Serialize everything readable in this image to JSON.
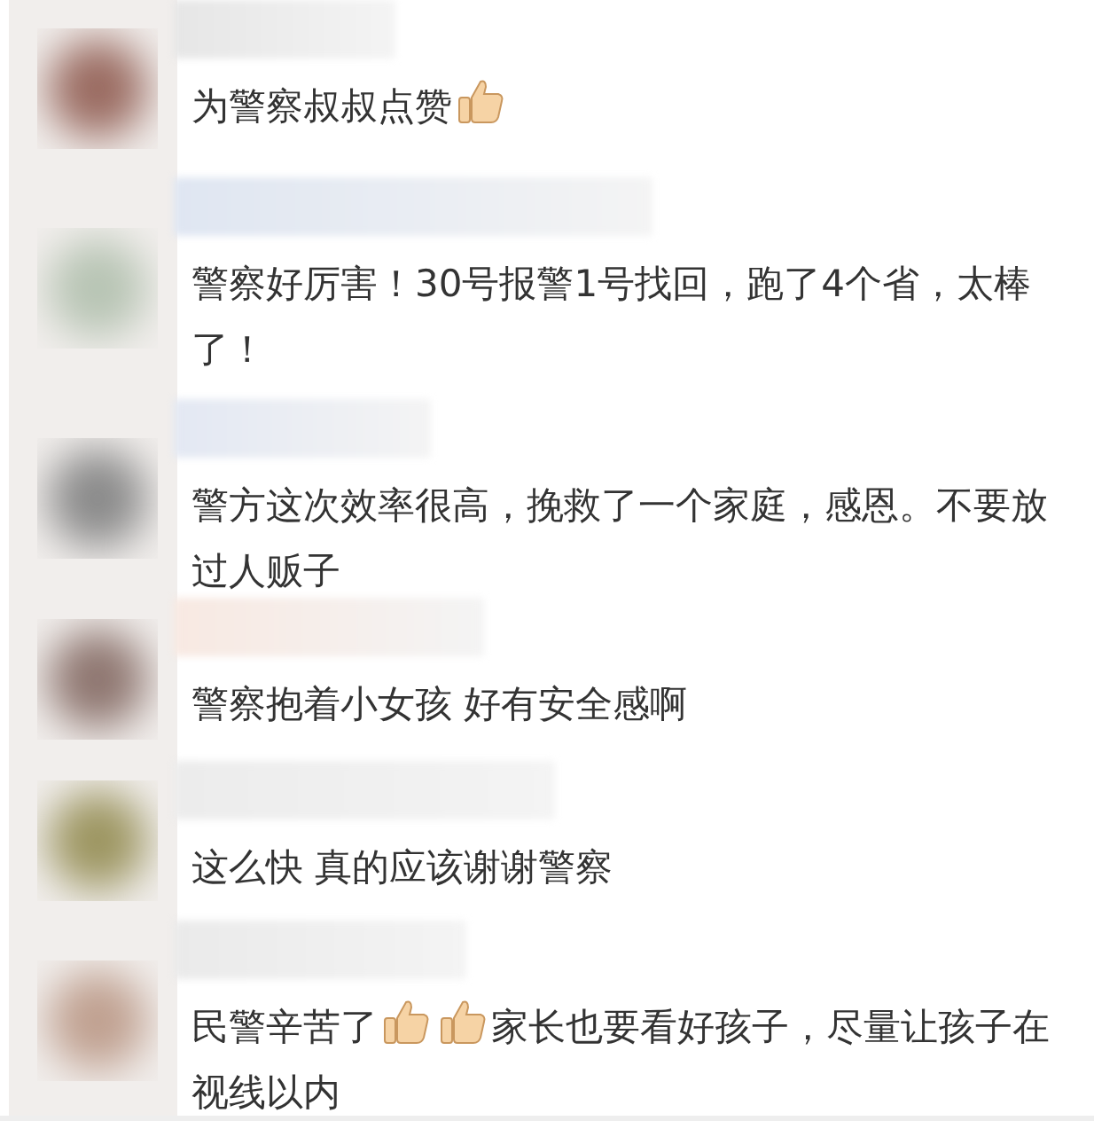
{
  "comments": [
    {
      "parts": [
        {
          "kind": "text",
          "text": "为警察叔叔点赞"
        },
        {
          "kind": "thumb"
        }
      ]
    },
    {
      "parts": [
        {
          "kind": "text",
          "text": "警察好厉害！30号报警1号找回，跑了4个省，太棒了！"
        }
      ]
    },
    {
      "parts": [
        {
          "kind": "text",
          "text": "警方这次效率很高，挽救了一个家庭，感恩。不要放过人贩子"
        }
      ]
    },
    {
      "parts": [
        {
          "kind": "text",
          "text": "警察抱着小女孩 好有安全感啊"
        }
      ]
    },
    {
      "parts": [
        {
          "kind": "text",
          "text": "这么快 真的应该谢谢警察"
        }
      ]
    },
    {
      "parts": [
        {
          "kind": "text",
          "text": "民警辛苦了"
        },
        {
          "kind": "thumb"
        },
        {
          "kind": "thumb"
        },
        {
          "kind": "text",
          "text": "家长也要看好孩子，尽量让孩子在视线以内"
        }
      ]
    }
  ]
}
